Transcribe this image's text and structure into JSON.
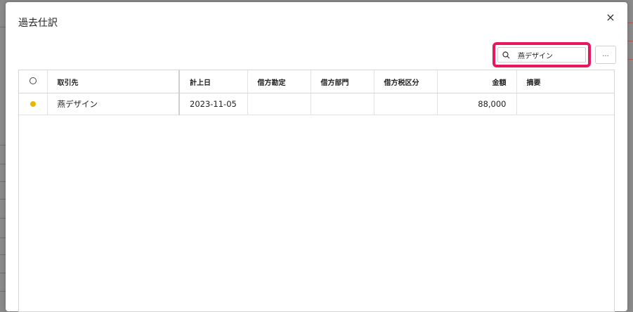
{
  "modal": {
    "title": "過去仕訳",
    "close_label": "×"
  },
  "search": {
    "value": "燕デザイン",
    "placeholder": ""
  },
  "more_button": {
    "label": "..."
  },
  "table": {
    "headers": [
      "取引先",
      "計上日",
      "借方勘定",
      "借方部門",
      "借方税区分",
      "金額",
      "摘要"
    ],
    "rows": [
      {
        "status_color": "#e8b800",
        "partner": "燕デザイン",
        "date": "2023-11-05",
        "debit_account": "",
        "debit_department": "",
        "debit_tax_category": "",
        "amount": "88,000",
        "memo": ""
      }
    ]
  },
  "colors": {
    "highlight": "#e8175d",
    "status_dot": "#e8b800",
    "overlay": "#8a8a8a"
  }
}
